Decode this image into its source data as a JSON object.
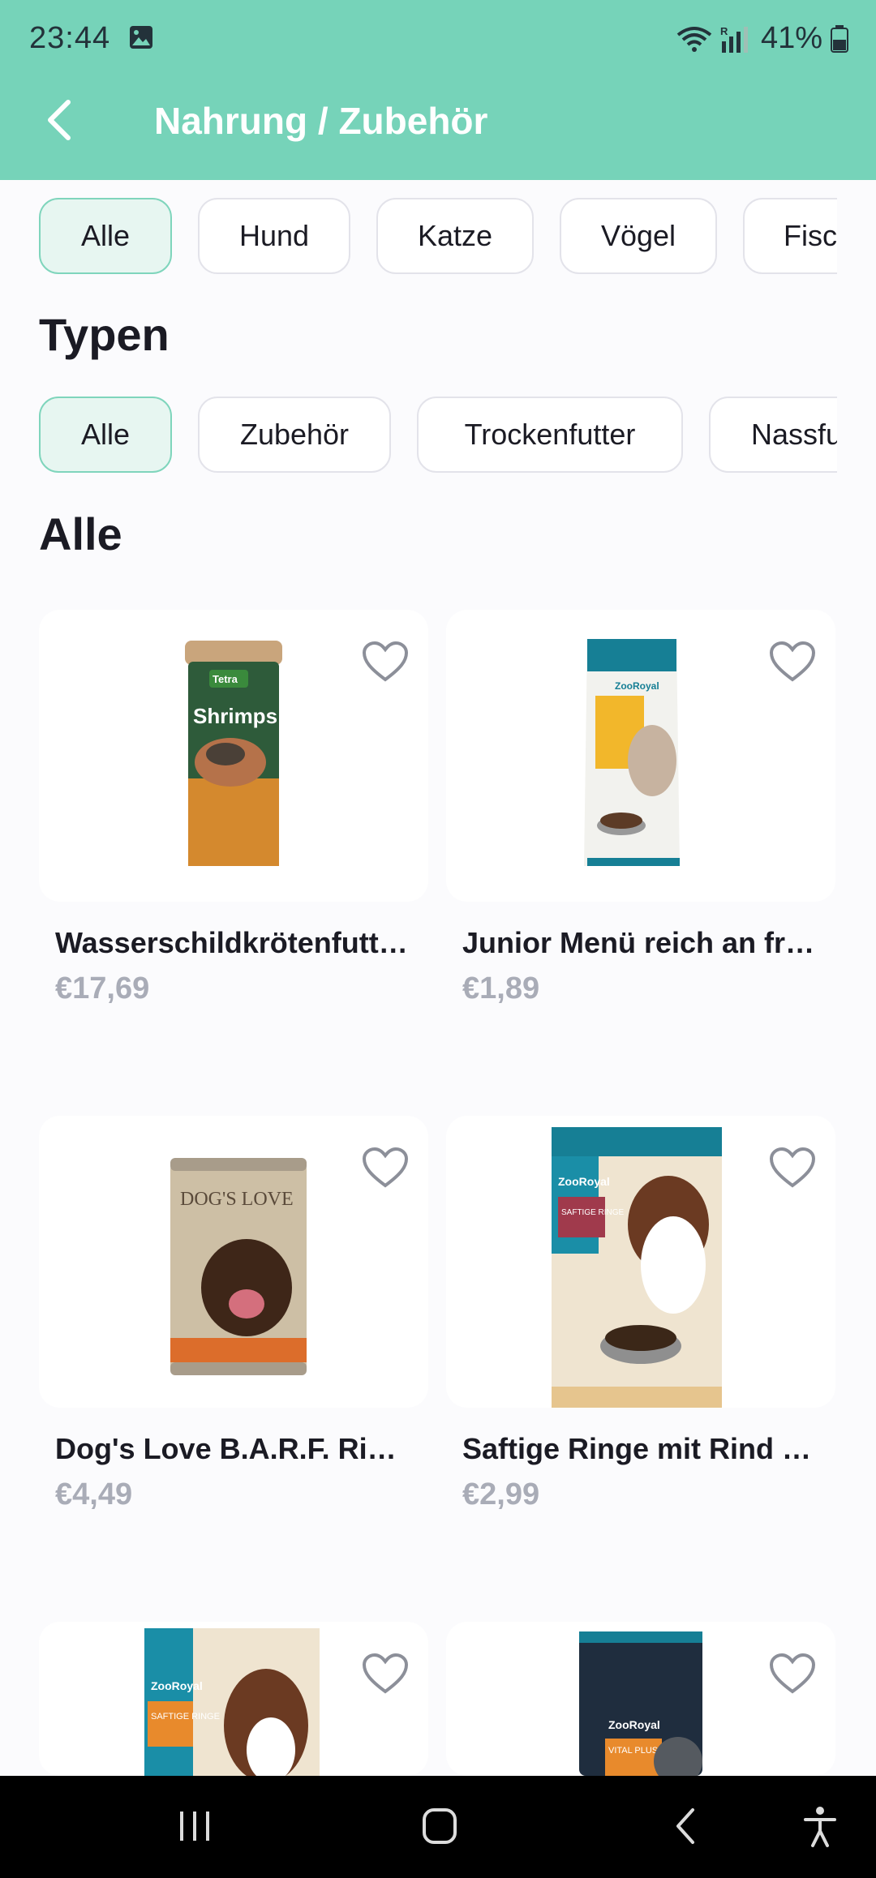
{
  "status_bar": {
    "time": "23:44",
    "battery": "41%",
    "icons": [
      "gallery-icon",
      "wifi-icon",
      "signal-icon",
      "battery-icon"
    ]
  },
  "app_bar": {
    "title": "Nahrung / Zubehör",
    "back_icon": "chevron-left-icon"
  },
  "animal_filters": [
    "Alle",
    "Hund",
    "Katze",
    "Vögel",
    "Fisc"
  ],
  "types_heading": "Typen",
  "type_filters": [
    "Alle",
    "Zubehör",
    "Trockenfutter",
    "Nassfu"
  ],
  "list_heading": "Alle",
  "products": [
    {
      "name": "Wasserschildkrötenfutt…",
      "price": "€17,69",
      "brand": "Tetra",
      "label": "Shrimps",
      "image": "Tetra ReptoDelica Shrimps tub"
    },
    {
      "name": "Junior Menü reich an fri…",
      "price": "€1,89",
      "brand": "ZooRoyal",
      "image": "ZooRoyal kitten food bag"
    },
    {
      "name": "Dog's Love B.A.R.F. Rin…",
      "price": "€4,49",
      "brand": "DOG'S LOVE",
      "image": "Dog's Love tin can"
    },
    {
      "name": "Saftige Ringe mit Rind …",
      "price": "€2,99",
      "brand": "ZooRoyal",
      "label": "SAFTIGE RINGE",
      "image": "ZooRoyal dog food bag"
    },
    {
      "name": "",
      "price": "",
      "brand": "ZooRoyal",
      "label": "SAFTIGE RINGE",
      "image": "ZooRoyal dog food bag"
    },
    {
      "name": "",
      "price": "",
      "brand": "ZooRoyal",
      "label": "VITAL PLUS",
      "image": "ZooRoyal dark food bag"
    }
  ],
  "colors": {
    "accent": "#76d3b9",
    "chip_active_bg": "#e7f6f1",
    "chip_active_border": "#7fd5bc",
    "price": "#a9acb7",
    "background": "#fbfbfd"
  },
  "nav_bar": [
    "recents-icon",
    "home-icon",
    "back-icon",
    "accessibility-icon"
  ]
}
